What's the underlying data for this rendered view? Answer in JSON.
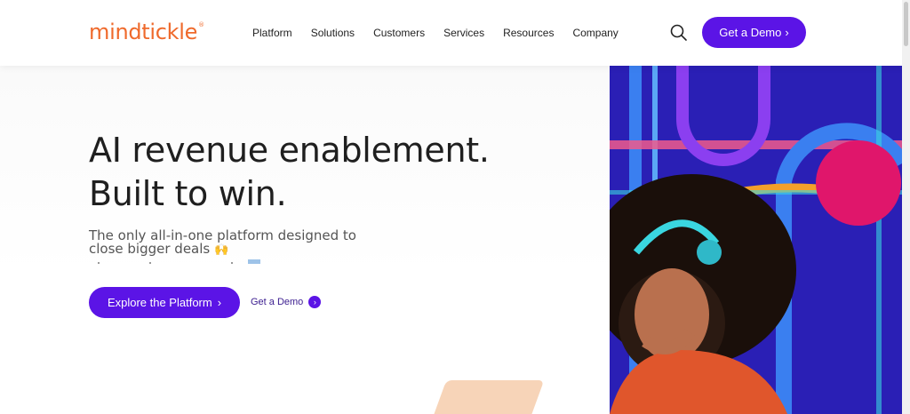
{
  "header": {
    "logo": "mindtickle",
    "logo_mark": "®",
    "nav": [
      "Platform",
      "Solutions",
      "Customers",
      "Services",
      "Resources",
      "Company"
    ],
    "search_icon": "search-icon",
    "demo_button": "Get a Demo",
    "demo_button_chevron": "›"
  },
  "hero": {
    "headline_line1": "AI revenue enablement.",
    "headline_line2": "Built to win.",
    "subhead_line1": "The only all-in-one platform designed to",
    "subhead_line2": "close bigger deals",
    "subhead_emoji": "🙌",
    "primary_cta": "Explore the Platform",
    "primary_cta_chevron": "›",
    "secondary_cta": "Get a Demo",
    "secondary_cta_chevron": "›"
  },
  "colors": {
    "brand_orange": "#ef6a2c",
    "brand_purple": "#5b14e6",
    "art_background": "#2a1fb5",
    "accent_pink": "#e0166b",
    "accent_cyan": "#3ad6e0"
  }
}
